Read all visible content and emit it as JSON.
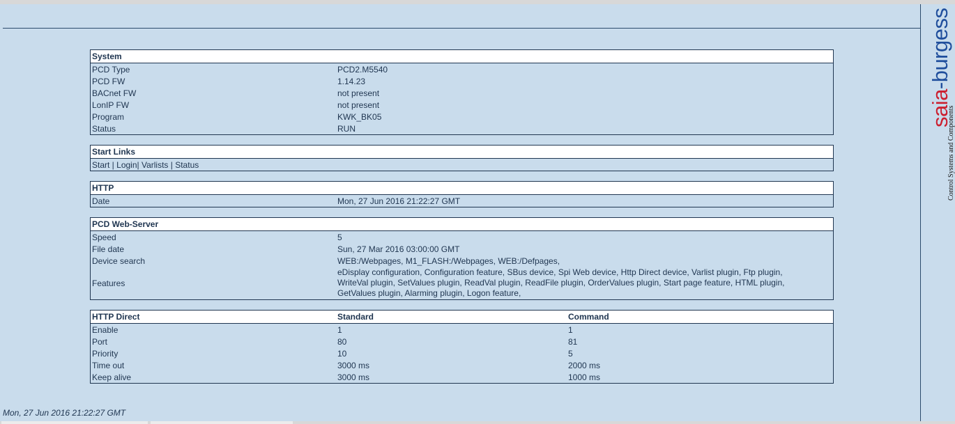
{
  "logo": {
    "brand": "saia-burgess",
    "brand_part1": "saia",
    "brand_part2": "-burgess",
    "tagline": "Control Systems and Components"
  },
  "system": {
    "title": "System",
    "rows": [
      {
        "label": "PCD Type",
        "value": "PCD2.M5540"
      },
      {
        "label": "PCD FW",
        "value": "1.14.23"
      },
      {
        "label": "BACnet FW",
        "value": "not present"
      },
      {
        "label": "LonIP FW",
        "value": "not present"
      },
      {
        "label": "Program",
        "value": "KWK_BK05"
      },
      {
        "label": "Status",
        "value": "RUN"
      }
    ]
  },
  "start_links": {
    "title": "Start Links",
    "links": [
      "Start",
      "Login",
      "Varlists",
      "Status"
    ],
    "sep1": " | ",
    "sep2": "| ",
    "sep3": " | "
  },
  "http": {
    "title": "HTTP",
    "date_label": "Date",
    "date_value": "Mon, 27 Jun 2016 21:22:27 GMT"
  },
  "web_server": {
    "title": "PCD Web-Server",
    "speed_label": "Speed",
    "speed_value": "5",
    "file_date_label": "File date",
    "file_date_value": "Sun, 27 Mar 2016 03:00:00 GMT",
    "device_search_label": "Device search",
    "device_search_value": "WEB:/Webpages, M1_FLASH:/Webpages, WEB:/Defpages,",
    "features_label": "Features",
    "features_lines": [
      "eDisplay configuration, Configuration feature, SBus device, Spi Web device, Http Direct device, Varlist plugin, Ftp plugin,",
      "WriteVal plugin, SetValues plugin, ReadVal plugin, ReadFile plugin, OrderValues plugin, Start page feature, HTML plugin,",
      "GetValues plugin, Alarming plugin, Logon feature,"
    ]
  },
  "http_direct": {
    "title": "HTTP Direct",
    "col_standard": "Standard",
    "col_command": "Command",
    "rows": [
      {
        "label": "Enable",
        "standard": "1",
        "command": "1"
      },
      {
        "label": "Port",
        "standard": "80",
        "command": "81"
      },
      {
        "label": "Priority",
        "standard": "10",
        "command": "5"
      },
      {
        "label": "Time out",
        "standard": "3000 ms",
        "command": "2000 ms"
      },
      {
        "label": "Keep alive",
        "standard": "3000 ms",
        "command": "1000 ms"
      }
    ]
  },
  "footer": {
    "timestamp": "Mon, 27 Jun 2016 21:22:27 GMT"
  },
  "colors": {
    "background": "#c9dcec",
    "text": "#1f3550",
    "header_bg": "#ffffff",
    "logo_red": "#cc1f2f",
    "logo_blue": "#1f4e9c"
  }
}
